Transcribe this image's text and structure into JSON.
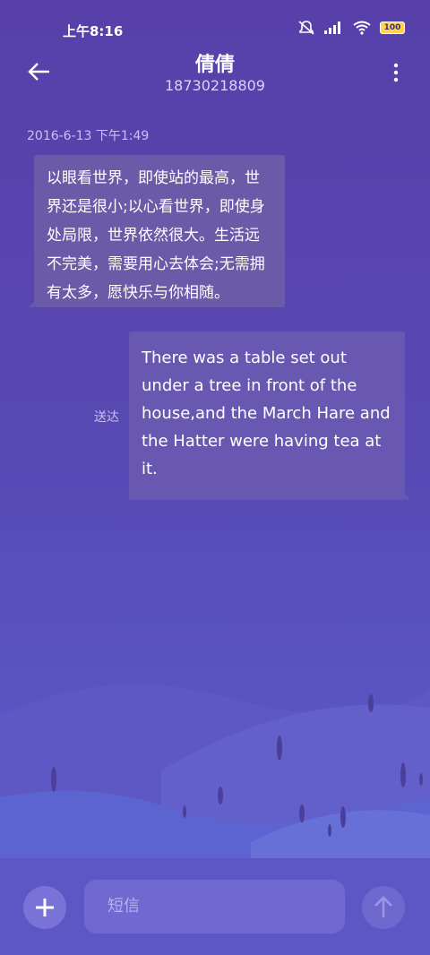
{
  "status_bar": {
    "time": "上午8:16",
    "battery": "100"
  },
  "header": {
    "title": "倩倩",
    "subtitle": "18730218809"
  },
  "conversation": {
    "timestamp": "2016-6-13 下午1:49",
    "incoming": {
      "text": "以眼看世界，即使站的最高，世界还是很小;以心看世界，即使身处局限，世界依然很大。生活远不完美，需要用心去体会;无需拥有太多，愿快乐与你相随。"
    },
    "outgoing": {
      "text": "There was a table set out under a tree in front of the house,and the March Hare and the Hatter were having tea at it.",
      "status": "送达"
    }
  },
  "composer": {
    "placeholder": "短信"
  },
  "colors": {
    "background": "#5848b3",
    "bubble": "#6a5aa8",
    "accent": "#7168d2"
  },
  "icons": {
    "back": "arrow-left-icon",
    "more": "more-vertical-icon",
    "add": "plus-icon",
    "send": "arrow-up-icon",
    "mute": "bell-off-icon",
    "signal": "signal-icon",
    "wifi": "wifi-icon",
    "battery": "battery-icon"
  }
}
